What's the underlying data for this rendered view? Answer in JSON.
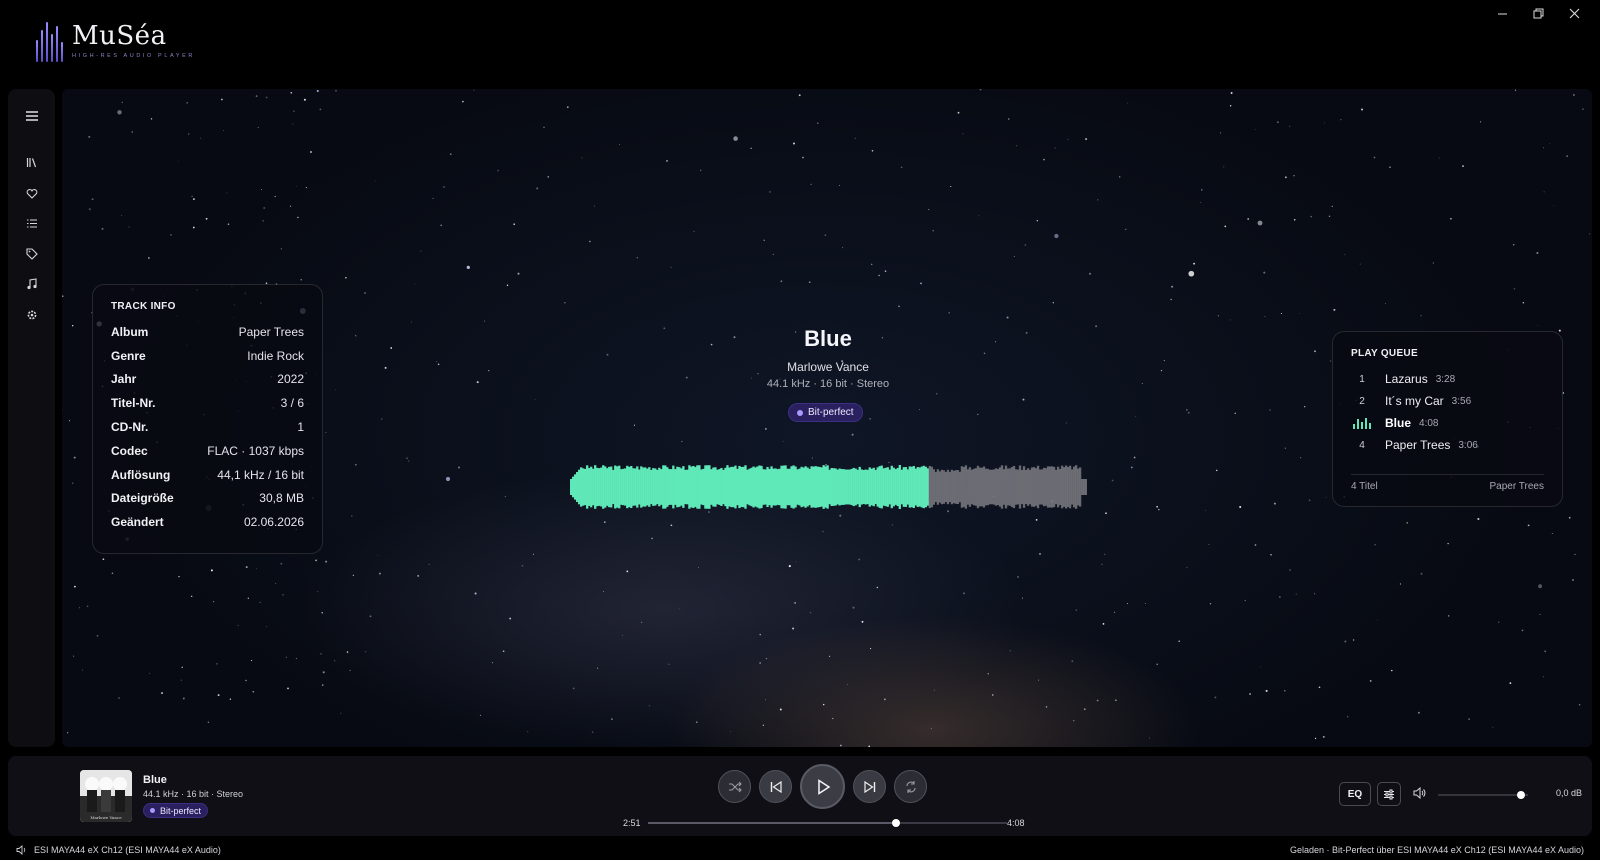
{
  "app": {
    "name": "MuSéa",
    "tagline": "HIGH-RES AUDIO PLAYER"
  },
  "window_controls": [
    "minimize",
    "restore",
    "close"
  ],
  "sidebar": {
    "items": [
      {
        "icon": "menu-icon"
      },
      {
        "icon": "library-icon"
      },
      {
        "icon": "heart-icon"
      },
      {
        "icon": "list-icon"
      },
      {
        "icon": "tag-icon"
      },
      {
        "icon": "music-note-icon"
      },
      {
        "icon": "gear-icon"
      }
    ]
  },
  "track_info": {
    "title": "TRACK INFO",
    "rows": [
      {
        "key": "Album",
        "value": "Paper Trees"
      },
      {
        "key": "Genre",
        "value": "Indie Rock"
      },
      {
        "key": "Jahr",
        "value": "2022"
      },
      {
        "key": "Titel-Nr.",
        "value": "3 / 6"
      },
      {
        "key": "CD-Nr.",
        "value": "1"
      },
      {
        "key": "Codec",
        "value": "FLAC · 1037 kbps"
      },
      {
        "key": "Auflösung",
        "value": "44,1 kHz / 16 bit"
      },
      {
        "key": "Dateigröße",
        "value": "30,8 MB"
      },
      {
        "key": "Geändert",
        "value": "02.06.2026"
      }
    ]
  },
  "now_playing": {
    "title": "Blue",
    "artist": "Marlowe Vance",
    "format": "44.1 kHz · 16 bit · Stereo",
    "badge": "Bit-perfect",
    "progress_fraction": 0.69
  },
  "queue": {
    "title": "PLAY QUEUE",
    "items": [
      {
        "num": "1",
        "title": "Lazarus",
        "duration": "3:28"
      },
      {
        "num": "2",
        "title": "It´s my Car",
        "duration": "3:56"
      },
      {
        "num": "",
        "title": "Blue",
        "duration": "4:08"
      },
      {
        "num": "4",
        "title": "Paper Trees",
        "duration": "3:06"
      }
    ],
    "footer_left": "4 Titel",
    "footer_right": "Paper Trees"
  },
  "player": {
    "cover_caption": "Marlowe Vance",
    "title": "Blue",
    "format": "44.1 kHz · 16 bit · Stereo",
    "badge": "Bit-perfect",
    "elapsed": "2:51",
    "total": "4:08",
    "seek_fraction": 0.69,
    "eq_label": "EQ",
    "volume_fraction": 0.92,
    "volume_db": "0,0 dB"
  },
  "status": {
    "device": "ESI MAYA44 eX Ch12 (ESI MAYA44 eX Audio)",
    "message": "Geladen · Bit-Perfect über ESI MAYA44 eX Ch12 (ESI MAYA44 eX Audio)"
  },
  "colors": {
    "accent": "#5fe8b8",
    "badge_bg": "#2a2060",
    "waveform_played": "#5fe8b8",
    "waveform_unplayed": "#7a7a80"
  }
}
